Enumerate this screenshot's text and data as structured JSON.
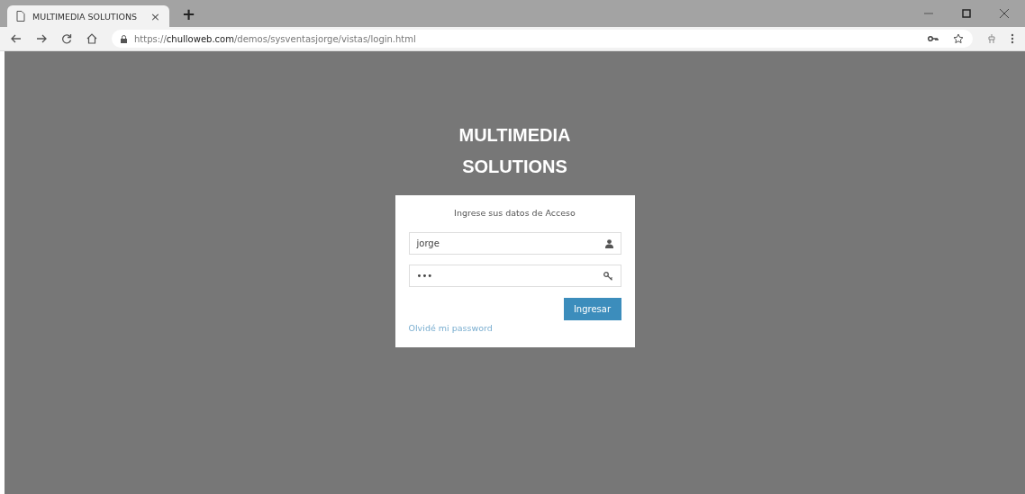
{
  "browser": {
    "tab": {
      "title": "MULTIMEDIA SOLUTIONS",
      "close": "×",
      "selected": true
    },
    "new_tab": "+",
    "url": {
      "scheme": "https://",
      "host": "chulloweb.com",
      "path": "/demos/sysventasjorge/vistas/login.html"
    }
  },
  "page": {
    "title_lines": [
      "MULTIMEDIA",
      "SOLUTIONS"
    ],
    "login": {
      "prompt": "Ingrese sus datos de Acceso",
      "fields": [
        {
          "kind": "user",
          "value": "jorge"
        },
        {
          "kind": "password",
          "value": "•••"
        }
      ],
      "button": "Ingresar",
      "link": "Olvidé mi password"
    }
  }
}
